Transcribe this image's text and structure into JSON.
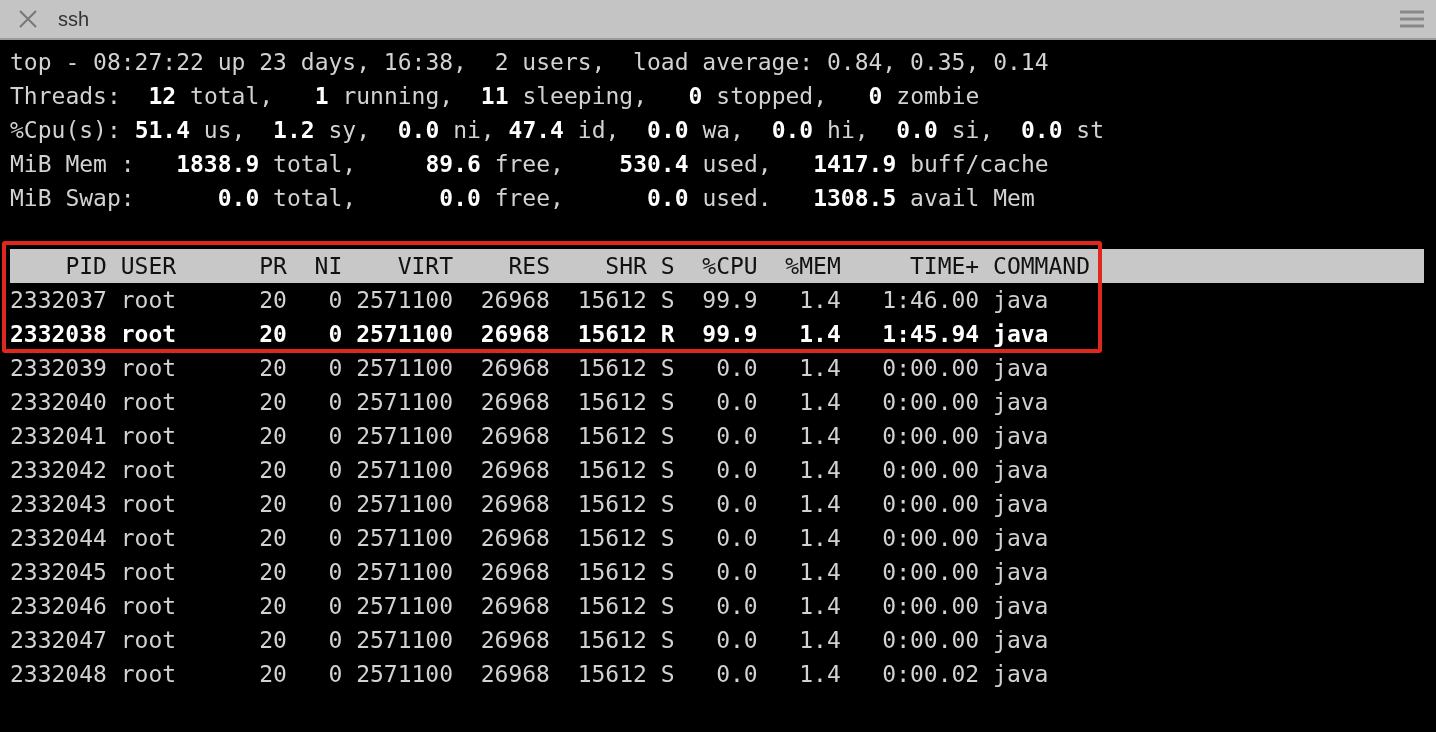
{
  "window": {
    "title": "ssh"
  },
  "summary": [
    "top - 08:27:22 up 23 days, 16:38,  2 users,  load average: 0.84, 0.35, 0.14",
    "Threads:  **12** total,   **1** running,  **11** sleeping,   **0** stopped,   **0** zombie",
    "%Cpu(s): **51.4** us,  **1.2** sy,  **0.0** ni, **47.4** id,  **0.0** wa,  **0.0** hi,  **0.0** si,  **0.0** st",
    "MiB Mem :   **1838.9** total,     **89.6** free,    **530.4** used,   **1417.9** buff/cache",
    "MiB Swap:      **0.0** total,      **0.0** free,      **0.0** used.   **1308.5** avail Mem"
  ],
  "table": {
    "columns": [
      "PID",
      "USER",
      "PR",
      "NI",
      "VIRT",
      "RES",
      "SHR",
      "S",
      "%CPU",
      "%MEM",
      "TIME+",
      "COMMAND"
    ],
    "rows": [
      {
        "cells": [
          "2332037",
          "root",
          "20",
          "0",
          "2571100",
          "26968",
          "15612",
          "S",
          "99.9",
          "1.4",
          "1:46.00",
          "java"
        ],
        "bold": false,
        "boxed": true
      },
      {
        "cells": [
          "2332038",
          "root",
          "20",
          "0",
          "2571100",
          "26968",
          "15612",
          "R",
          "99.9",
          "1.4",
          "1:45.94",
          "java"
        ],
        "bold": true,
        "boxed": true
      },
      {
        "cells": [
          "2332039",
          "root",
          "20",
          "0",
          "2571100",
          "26968",
          "15612",
          "S",
          "0.0",
          "1.4",
          "0:00.00",
          "java"
        ],
        "bold": false,
        "boxed": false
      },
      {
        "cells": [
          "2332040",
          "root",
          "20",
          "0",
          "2571100",
          "26968",
          "15612",
          "S",
          "0.0",
          "1.4",
          "0:00.00",
          "java"
        ],
        "bold": false,
        "boxed": false
      },
      {
        "cells": [
          "2332041",
          "root",
          "20",
          "0",
          "2571100",
          "26968",
          "15612",
          "S",
          "0.0",
          "1.4",
          "0:00.00",
          "java"
        ],
        "bold": false,
        "boxed": false
      },
      {
        "cells": [
          "2332042",
          "root",
          "20",
          "0",
          "2571100",
          "26968",
          "15612",
          "S",
          "0.0",
          "1.4",
          "0:00.00",
          "java"
        ],
        "bold": false,
        "boxed": false
      },
      {
        "cells": [
          "2332043",
          "root",
          "20",
          "0",
          "2571100",
          "26968",
          "15612",
          "S",
          "0.0",
          "1.4",
          "0:00.00",
          "java"
        ],
        "bold": false,
        "boxed": false
      },
      {
        "cells": [
          "2332044",
          "root",
          "20",
          "0",
          "2571100",
          "26968",
          "15612",
          "S",
          "0.0",
          "1.4",
          "0:00.00",
          "java"
        ],
        "bold": false,
        "boxed": false
      },
      {
        "cells": [
          "2332045",
          "root",
          "20",
          "0",
          "2571100",
          "26968",
          "15612",
          "S",
          "0.0",
          "1.4",
          "0:00.00",
          "java"
        ],
        "bold": false,
        "boxed": false
      },
      {
        "cells": [
          "2332046",
          "root",
          "20",
          "0",
          "2571100",
          "26968",
          "15612",
          "S",
          "0.0",
          "1.4",
          "0:00.00",
          "java"
        ],
        "bold": false,
        "boxed": false
      },
      {
        "cells": [
          "2332047",
          "root",
          "20",
          "0",
          "2571100",
          "26968",
          "15612",
          "S",
          "0.0",
          "1.4",
          "0:00.00",
          "java"
        ],
        "bold": false,
        "boxed": false
      },
      {
        "cells": [
          "2332048",
          "root",
          "20",
          "0",
          "2571100",
          "26968",
          "15612",
          "S",
          "0.0",
          "1.4",
          "0:00.02",
          "java"
        ],
        "bold": false,
        "boxed": false
      }
    ]
  }
}
